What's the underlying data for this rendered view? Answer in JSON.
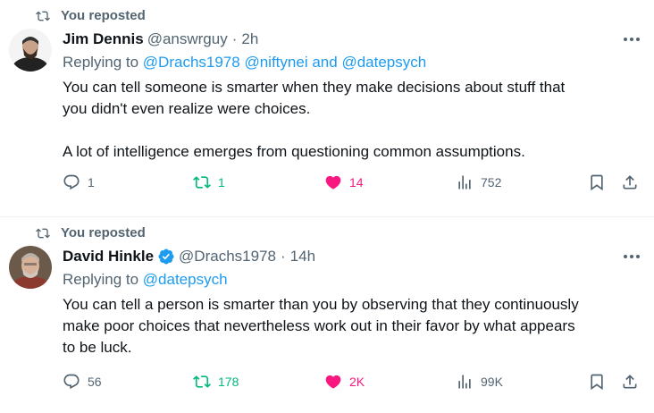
{
  "tweets": [
    {
      "repost_label": "You reposted",
      "name": "Jim Dennis",
      "handle": "@answrguy",
      "separator": "·",
      "time": "2h",
      "replying_prefix": "Replying to",
      "mentions": [
        "@Drachs1978",
        "@niftynei",
        "@datepsych"
      ],
      "mention_joiner": "and",
      "text": "You can tell someone is smarter when they make decisions about stuff that\nyou didn't even realize were choices.\n\nA lot of intelligence emerges from questioning common assumptions.",
      "replies": "1",
      "reposts": "1",
      "likes": "14",
      "views": "752"
    },
    {
      "repost_label": "You reposted",
      "name": "David Hinkle",
      "handle": "@Drachs1978",
      "separator": "·",
      "time": "14h",
      "verified": true,
      "replying_prefix": "Replying to",
      "mentions": [
        "@datepsych"
      ],
      "text": "You can tell a person is smarter than you by observing that they continuously\nmake poor choices that nevertheless work out in their favor by what appears\nto be luck.",
      "replies": "56",
      "reposts": "178",
      "likes": "2K",
      "views": "99K"
    }
  ],
  "icons": {
    "repost": "repost-icon",
    "reply": "reply-icon",
    "like": "heart-icon",
    "views": "views-icon",
    "bookmark": "bookmark-icon",
    "share": "share-icon",
    "more": "more-icon",
    "verified": "verified-badge-icon"
  },
  "colors": {
    "accent": "#1d9bf0",
    "repost": "#00ba7c",
    "like": "#f91880",
    "secondary_text": "#536471"
  }
}
